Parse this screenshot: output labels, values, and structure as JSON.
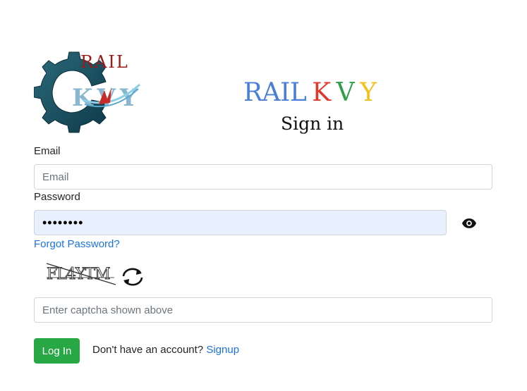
{
  "logo": {
    "text_top": "RAIL",
    "text_bottom": "KVY"
  },
  "brand": {
    "parts": [
      {
        "text": "RAIL",
        "color": "#4a7fd9"
      },
      {
        "text": "K",
        "color": "#e2382c"
      },
      {
        "text": "V",
        "color": "#2fa04a"
      },
      {
        "text": "Y",
        "color": "#f2c01d"
      }
    ],
    "heading": "Sign in"
  },
  "form": {
    "email_label": "Email",
    "email_placeholder": "Email",
    "email_value": "",
    "password_label": "Password",
    "password_value": "••••••••",
    "password_toggle_icon": "eye-icon",
    "forgot_password": "Forgot Password?",
    "captcha_text": "FL4YTM",
    "captcha_refresh_icon": "refresh-icon",
    "captcha_placeholder": "Enter captcha shown above",
    "captcha_value": "",
    "login_button": "Log In",
    "signup_prompt": "Don't have an account?",
    "signup_link": "Signup"
  },
  "colors": {
    "primary_link": "#1a73e8",
    "login_button": "#28a745",
    "autofill_bg": "#e8f0fe"
  }
}
